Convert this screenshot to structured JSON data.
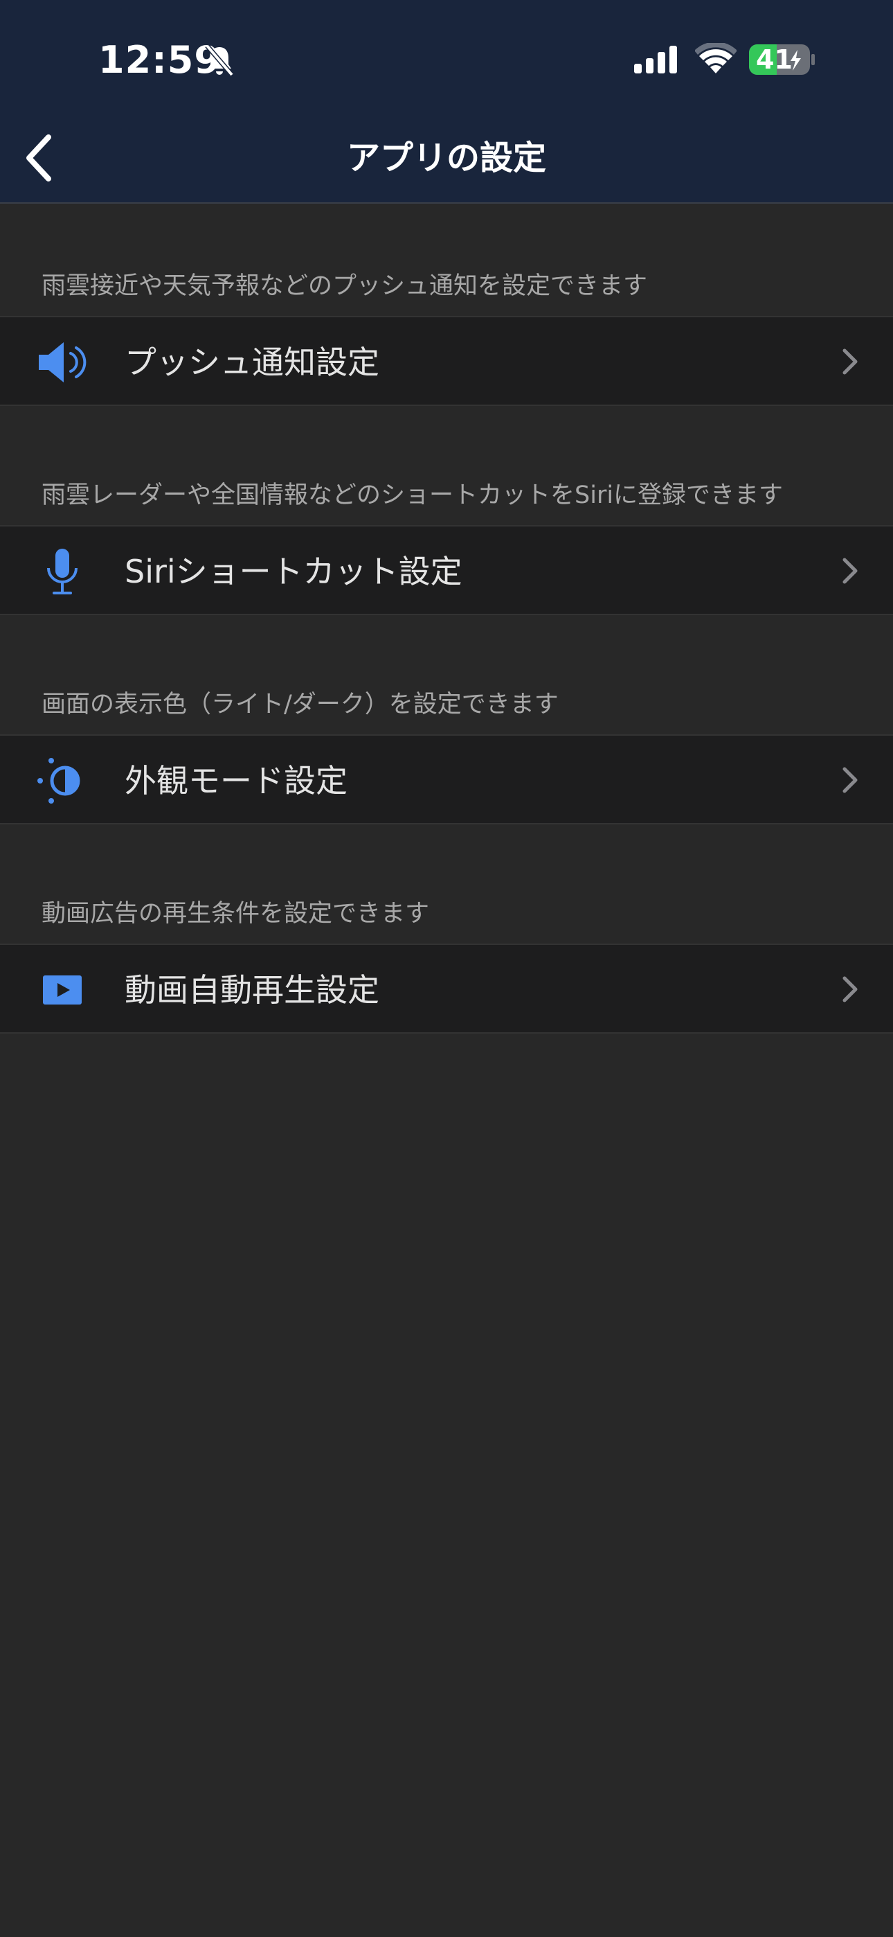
{
  "status_bar": {
    "time": "12:59",
    "battery": "41"
  },
  "nav": {
    "title": "アプリの設定"
  },
  "sections": [
    {
      "caption": "雨雲接近や天気予報などのプッシュ通知を設定できます",
      "label": "プッシュ通知設定",
      "icon": "speaker-icon"
    },
    {
      "caption": "雨雲レーダーや全国情報などのショートカットをSiriに登録できます",
      "label": "Siriショートカット設定",
      "icon": "microphone-icon"
    },
    {
      "caption": "画面の表示色（ライト/ダーク）を設定できます",
      "label": "外観モード設定",
      "icon": "brightness-icon"
    },
    {
      "caption": "動画広告の再生条件を設定できます",
      "label": "動画自動再生設定",
      "icon": "play-icon"
    }
  ],
  "colors": {
    "nav_bg": "#19253c",
    "page_bg": "#282828",
    "row_bg": "#1d1d1e",
    "accent": "#4c8ef0",
    "battery_green": "#34c759"
  }
}
